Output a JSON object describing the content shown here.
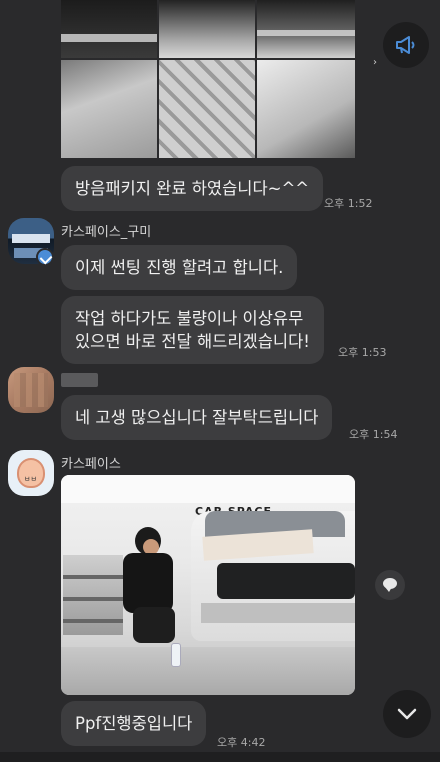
{
  "colors": {
    "background": "#2a2a2c",
    "bubble": "#3d3d3f",
    "announce_icon": "#4b8cd6"
  },
  "messages": [
    {
      "text": "방음패키지 완료 하였습니다~^^",
      "time": "오후 1:52"
    },
    {
      "sender": "카스페이스_구미",
      "text": "이제 썬팅 진행 할려고 합니다."
    },
    {
      "text_line1": "작업 하다가도 불량이나 이상유무",
      "text_line2": "있으면 바로 전달 해드리겠습니다!",
      "time": "오후 1:53"
    },
    {
      "text": "네 고생 많으십니다 잘부탁드립니다",
      "time": "오후 1:54"
    },
    {
      "sender": "카스페이스",
      "photo_sign": "CAR SPACE"
    },
    {
      "text": "Ppf진행중입니다",
      "time": "오후 4:42"
    }
  ],
  "icons": {
    "announce": "megaphone-icon",
    "share": "share-bubble-icon",
    "scroll": "chevron-down-icon",
    "verified": "check-badge-icon"
  }
}
